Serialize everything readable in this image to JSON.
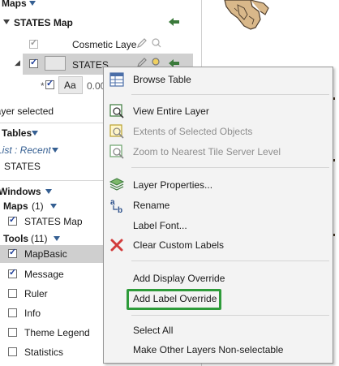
{
  "explorer": {
    "maps_header": "Maps",
    "states_map_title": "STATES Map",
    "cosmetic_layer": "Cosmetic Laye",
    "states_layer": "STATES",
    "label_aa": "Aa",
    "label_value": "0.00",
    "layer_selected": "layer selected",
    "tables_header": "Tables",
    "list_recent": "List : Recent",
    "table_states": "STATES",
    "windows_header": "Windows",
    "maps_count": "Maps",
    "maps_count_value": "(1)",
    "states_map_window": "STATES Map",
    "tools_label": "Tools",
    "tools_count": "(11)",
    "tools": [
      {
        "label": "MapBasic",
        "checked": true
      },
      {
        "label": "Message",
        "checked": true
      },
      {
        "label": "Ruler",
        "checked": false
      },
      {
        "label": "Info",
        "checked": false
      },
      {
        "label": "Theme Legend",
        "checked": false
      },
      {
        "label": "Statistics",
        "checked": false
      }
    ]
  },
  "context_menu": {
    "items": {
      "browse_table": "Browse Table",
      "view_entire_layer": "View Entire Layer",
      "extents_selected": "Extents of Selected Objects",
      "zoom_nearest": "Zoom to Nearest Tile Server Level",
      "layer_properties": "Layer Properties...",
      "rename": "Rename",
      "label_font": "Label Font...",
      "clear_custom_labels": "Clear Custom Labels",
      "add_display_override": "Add Display Override",
      "add_label_override": "Add Label Override",
      "select_all": "Select All",
      "make_other_nonselectable": "Make Other Layers Non-selectable"
    },
    "highlight_color": "#2e9b3a"
  },
  "map": {
    "fill_color": "#d9b88a",
    "outline_color": "#4a3a2a"
  }
}
